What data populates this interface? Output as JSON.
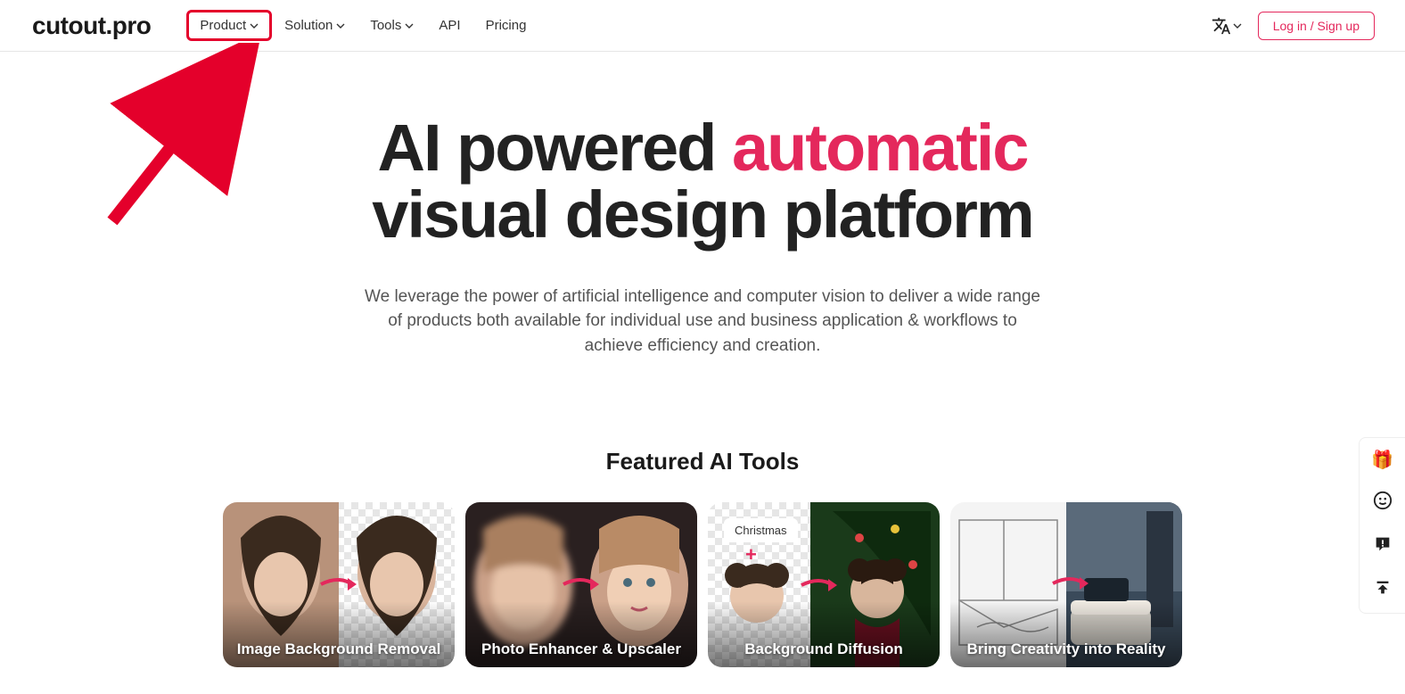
{
  "nav": {
    "logo": "cutout.pro",
    "items": [
      {
        "label": "Product",
        "hasDropdown": true,
        "highlighted": true
      },
      {
        "label": "Solution",
        "hasDropdown": true
      },
      {
        "label": "Tools",
        "hasDropdown": true
      },
      {
        "label": "API",
        "hasDropdown": false
      },
      {
        "label": "Pricing",
        "hasDropdown": false
      }
    ],
    "loginLabel": "Log in / Sign up"
  },
  "hero": {
    "title_part1": "AI powered ",
    "title_accent": "automatic",
    "title_part2": " visual design platform",
    "subtitle": "We leverage the power of artificial intelligence and computer vision to deliver a wide range of products both available for individual use and business application & workflows to achieve efficiency and creation."
  },
  "section": {
    "title": "Featured AI Tools",
    "cards": [
      {
        "label": "Image Background Removal",
        "badge": null
      },
      {
        "label": "Photo Enhancer & Upscaler",
        "badge": null
      },
      {
        "label": "Background Diffusion",
        "badge": "Christmas"
      },
      {
        "label": "Bring Creativity into Reality",
        "badge": null
      }
    ]
  },
  "colors": {
    "accent": "#e4285c",
    "annotationRed": "#e4002b"
  }
}
